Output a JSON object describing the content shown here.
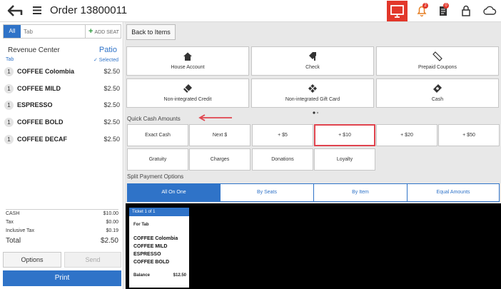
{
  "header": {
    "order_title": "Order 13800011",
    "bell_badge": "2",
    "doc_badge": "0",
    "colors": {
      "monitor_bg": "#e2372a",
      "accent": "#2f73c8",
      "highlight": "#e0444e"
    }
  },
  "left": {
    "tab_all": "All",
    "tab_placeholder": "Tab",
    "add_seat": "ADD SEAT",
    "revenue_center_label": "Revenue Center",
    "revenue_center_value": "Patio",
    "tab_label": "Tab",
    "selected_label": "Selected",
    "items": [
      {
        "qty": "1",
        "name": "COFFEE Colombia",
        "price": "$2.50"
      },
      {
        "qty": "1",
        "name": "COFFEE MILD",
        "price": "$2.50"
      },
      {
        "qty": "1",
        "name": "ESPRESSO",
        "price": "$2.50"
      },
      {
        "qty": "1",
        "name": "COFFEE BOLD",
        "price": "$2.50"
      },
      {
        "qty": "1",
        "name": "COFFEE DECAF",
        "price": "$2.50"
      }
    ],
    "totals": {
      "cash_label": "CASH",
      "cash_value": "$10.00",
      "tax_label": "Tax",
      "tax_value": "$0.00",
      "incl_tax_label": "Inclusive Tax",
      "incl_tax_value": "$0.19",
      "total_label": "Total",
      "total_value": "$2.50"
    },
    "options": "Options",
    "send": "Send",
    "print": "Print"
  },
  "right": {
    "back_to_items": "Back to Items",
    "payment_tiles": [
      {
        "label": "House Account",
        "icon": "home-icon"
      },
      {
        "label": "Check",
        "icon": "check-tag-icon"
      },
      {
        "label": "Prepaid Coupons",
        "icon": "coupon-icon"
      },
      {
        "label": "Non-integrated Credit",
        "icon": "credit-card-icon"
      },
      {
        "label": "Non-integrated Gift Card",
        "icon": "gift-card-icon"
      },
      {
        "label": "Cash",
        "icon": "cash-icon"
      }
    ],
    "quick_cash_label": "Quick Cash Amounts",
    "quick_cash": [
      "Exact Cash",
      "Next $",
      "+ $5",
      "+ $10",
      "+ $20",
      "+ $50"
    ],
    "extras": [
      "Gratuity",
      "Charges",
      "Donations",
      "Loyalty"
    ],
    "split_label": "Split Payment Options",
    "split_tabs": [
      "All On One",
      "By Seats",
      "By Item",
      "Equal Amounts"
    ],
    "ticket": {
      "title": "Ticket 1 of 1",
      "for": "For Tab",
      "items": [
        "COFFEE Colombia",
        "COFFEE MILD",
        "ESPRESSO",
        "COFFEE BOLD"
      ],
      "balance_label": "Balance",
      "balance_value": "$12.50"
    }
  }
}
